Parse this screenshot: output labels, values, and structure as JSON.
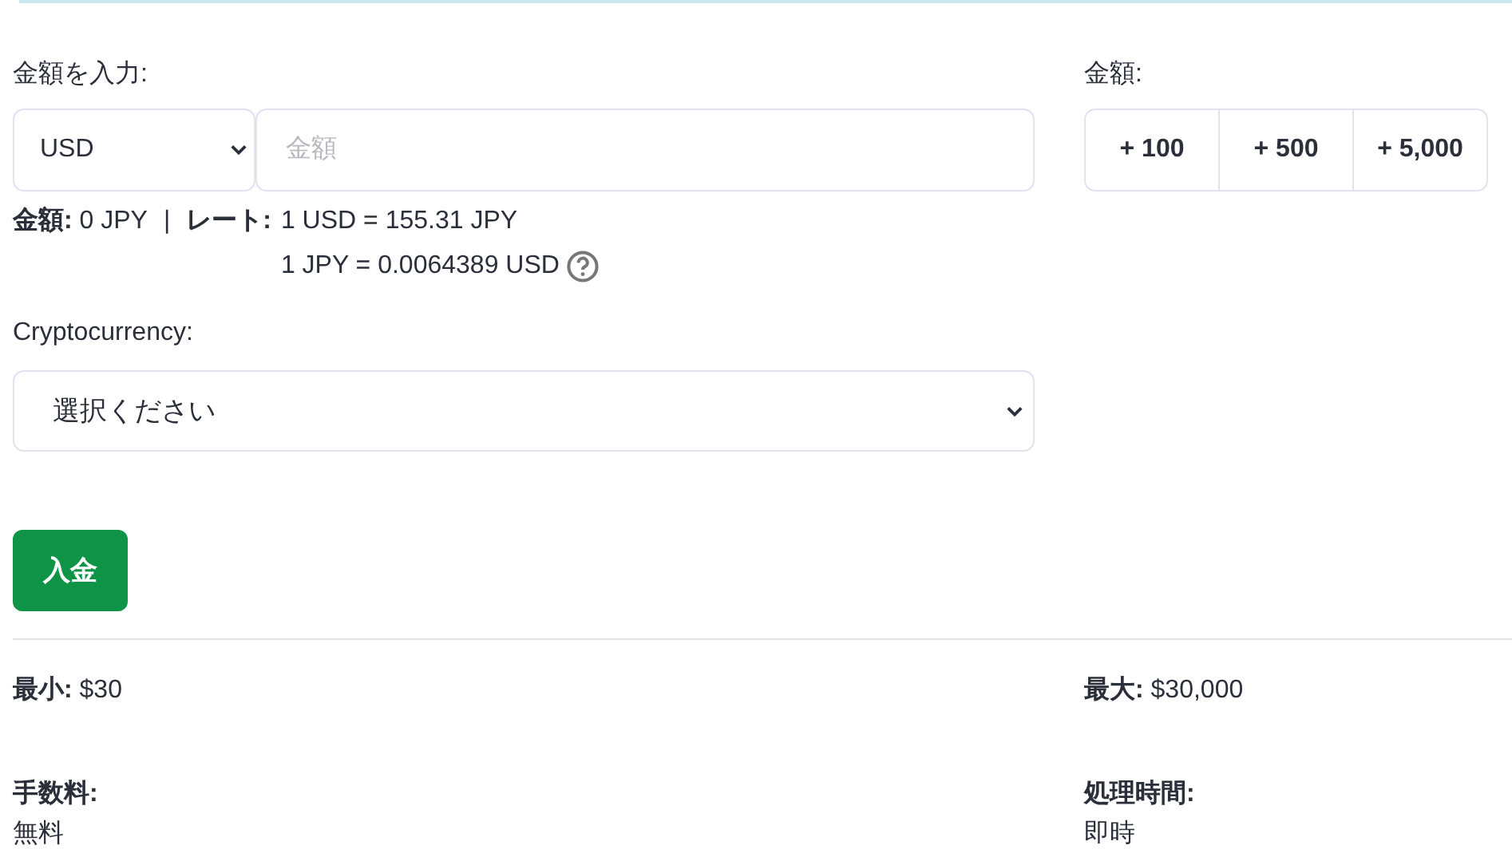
{
  "amount_section": {
    "label": "金額を入力:",
    "currency_select": {
      "value": "USD"
    },
    "amount_field": {
      "placeholder": "金額"
    },
    "summary": {
      "amount": "**金額:** 0 JPY",
      "separator": "|",
      "rate_label": "レート:",
      "rate_lines": [
        "1 USD = 155.31 JPY",
        "1 JPY = 0.0064389 USD"
      ]
    }
  },
  "quick_amounts": {
    "label": "金額:",
    "buttons": [
      "+ 100",
      "+ 500",
      "+ 5,000"
    ]
  },
  "crypto_section": {
    "label": "Cryptocurrency:",
    "select": {
      "value": "選択ください"
    }
  },
  "deposit_button": "入金",
  "limits": [
    {
      "text": "**最小:** $30"
    },
    {
      "text": "**最大:** $30,000"
    }
  ],
  "details": [
    {
      "label": "手数料:",
      "value": "無料"
    },
    {
      "label": "処理時間:",
      "value": "即時"
    }
  ]
}
